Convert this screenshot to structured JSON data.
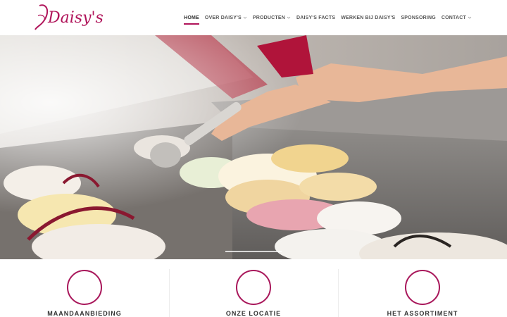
{
  "brand": {
    "logo_text": "Daisy's",
    "accent": "#b0145a"
  },
  "nav": {
    "items": [
      {
        "label": "HOME",
        "active": true,
        "dropdown": false
      },
      {
        "label": "OVER DAISY'S",
        "active": false,
        "dropdown": true
      },
      {
        "label": "PRODUCTEN",
        "active": false,
        "dropdown": true
      },
      {
        "label": "DAISY'S FACTS",
        "active": false,
        "dropdown": false
      },
      {
        "label": "WERKEN BIJ DAISY'S",
        "active": false,
        "dropdown": false
      },
      {
        "label": "SPONSORING",
        "active": false,
        "dropdown": false
      },
      {
        "label": "CONTACT",
        "active": false,
        "dropdown": true
      }
    ]
  },
  "features": [
    {
      "title": "MAANDAANBIEDING",
      "icon": "circle-outline-icon"
    },
    {
      "title": "ONZE LOCATIE",
      "icon": "circle-outline-icon"
    },
    {
      "title": "HET ASSORTIMENT",
      "icon": "circle-outline-icon"
    }
  ]
}
